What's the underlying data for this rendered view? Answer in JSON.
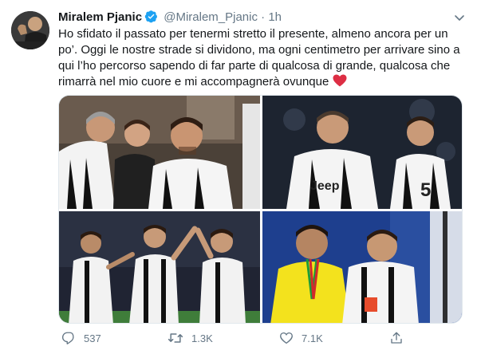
{
  "tweet": {
    "author_name": "Miralem Pjanic",
    "handle": "@Miralem_Pjanic",
    "separator": "·",
    "time": "1h",
    "text": "Ho sfidato il passato per tenermi stretto il presente, almeno ancora per un po’. Oggi le nostre strade si dividono, ma ogni centimetro per arrivare sino a qui l’ho percorso sapendo di far parte di qualcosa di grande, qualcosa che rimarrà nel mio cuore e mi accompagnerà ovunque",
    "photo_texts": {
      "shirt_sponsor": "Jeep",
      "shirt_number": "5"
    },
    "stats": {
      "replies": "537",
      "retweets": "1.3K",
      "likes": "7.1K"
    }
  },
  "icons": {
    "verified": "verified-badge-icon",
    "menu": "chevron-down-icon",
    "heart_emoji": "red-heart-icon",
    "reply": "reply-icon",
    "retweet": "retweet-icon",
    "like": "like-icon",
    "share": "share-icon"
  },
  "colors": {
    "accent": "#1da1f2",
    "text": "#14171a",
    "muted": "#657786",
    "heart": "#e0245e"
  }
}
